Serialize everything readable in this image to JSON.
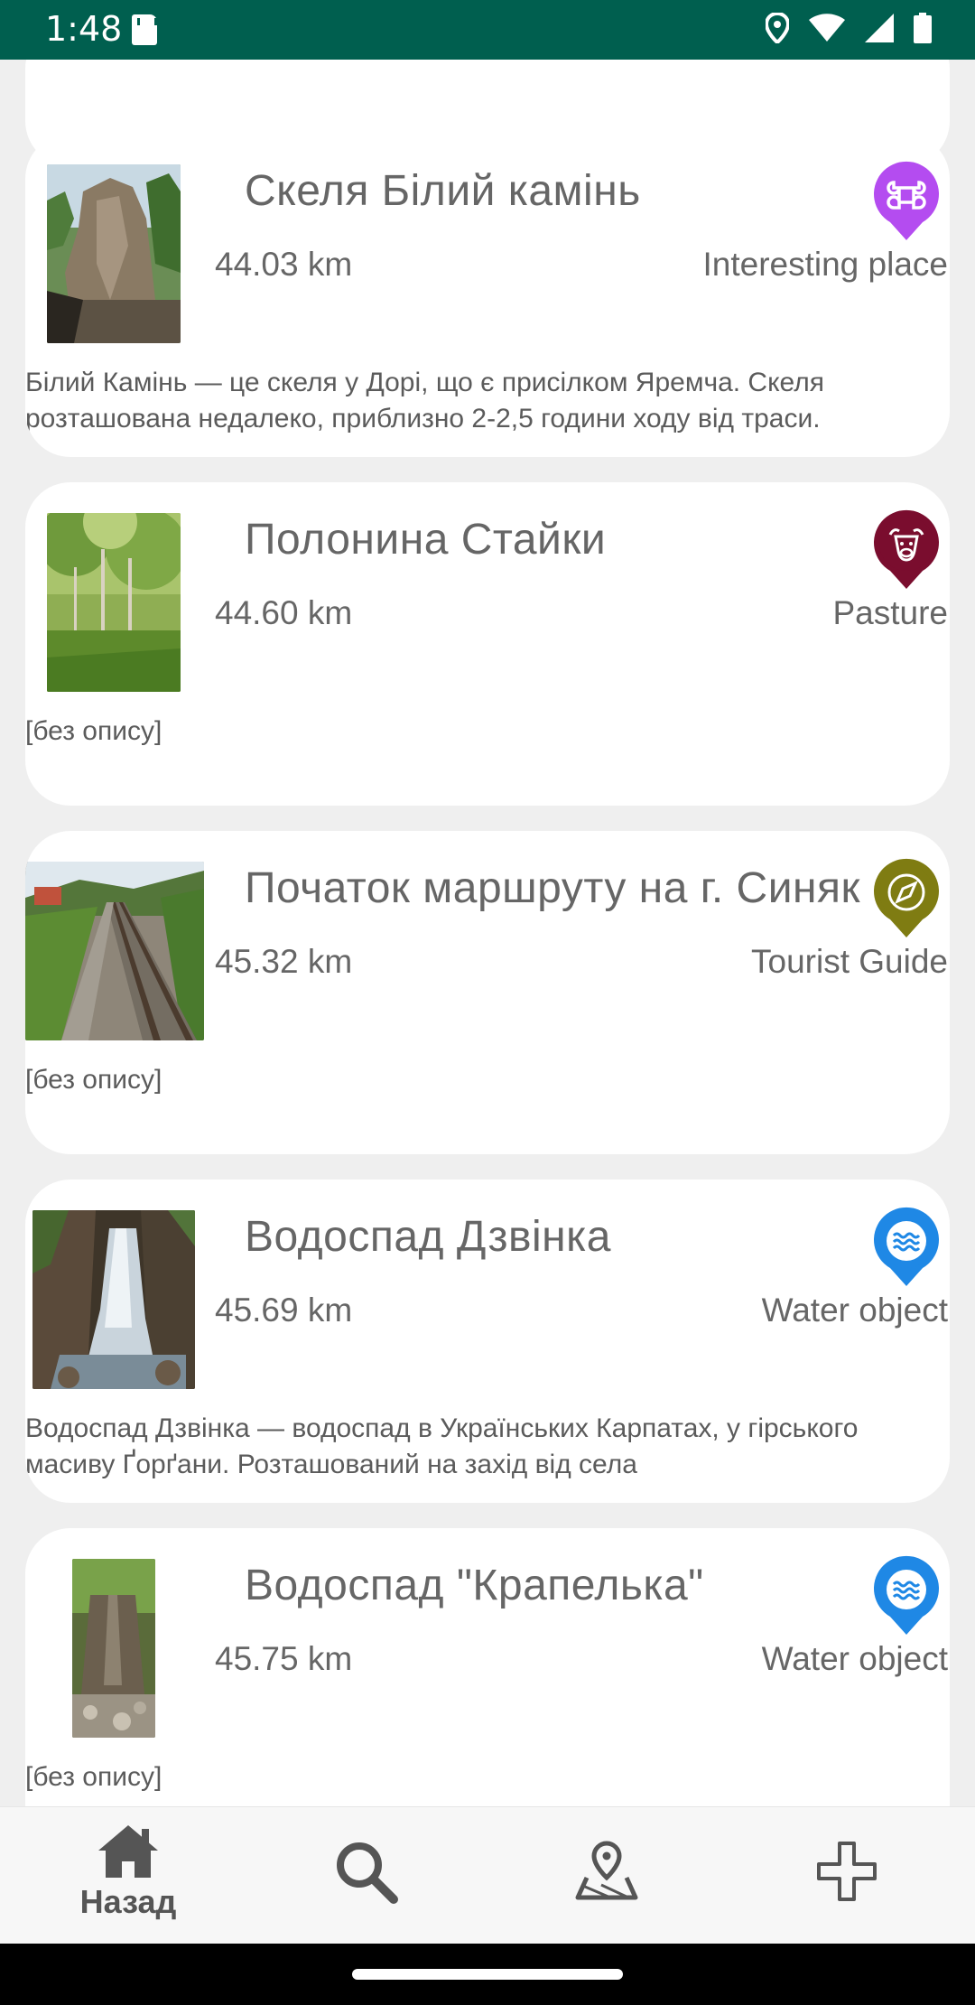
{
  "status_bar": {
    "time": "1:48"
  },
  "cards": [
    {
      "title": "Скеля Білий камінь",
      "distance": "44.03 km",
      "type": "Interesting place",
      "marker_icon": "command-icon",
      "marker_color": "#b44cf0",
      "description": "Білий Камінь — це скеля у Дорі, що є присілком Яремча. Скеля розташована недалеко, приблизно 2-2,5 години ходу від траси."
    },
    {
      "title": "Полонина Стайки",
      "distance": "44.60 km",
      "type": "Pasture",
      "marker_icon": "cow-icon",
      "marker_color": "#7a0d2e",
      "description": "[без опису]"
    },
    {
      "title": "Початок маршруту на г. Синяк",
      "distance": "45.32 km",
      "type": "Tourist Guide",
      "marker_icon": "compass-icon",
      "marker_color": "#7f7c12",
      "description": "[без опису]"
    },
    {
      "title": "Водоспад Дзвінка",
      "distance": "45.69 km",
      "type": "Water object",
      "marker_icon": "water-icon",
      "marker_color": "#1f88e5",
      "description": "Водоспад Дзвінка — водоспад в Українських Карпатах, у гірського масиву Ґорґани. Розташований на захід від села"
    },
    {
      "title": "Водоспад \"Крапелька\"",
      "distance": "45.75 km",
      "type": "Water object",
      "marker_icon": "water-icon",
      "marker_color": "#1f88e5",
      "description": "[без опису]"
    }
  ],
  "bottom_nav": {
    "home_label": "Назад",
    "home_icon": "home-icon",
    "search_icon": "search-icon",
    "map_icon": "map-pin-icon",
    "add_icon": "plus-icon"
  }
}
